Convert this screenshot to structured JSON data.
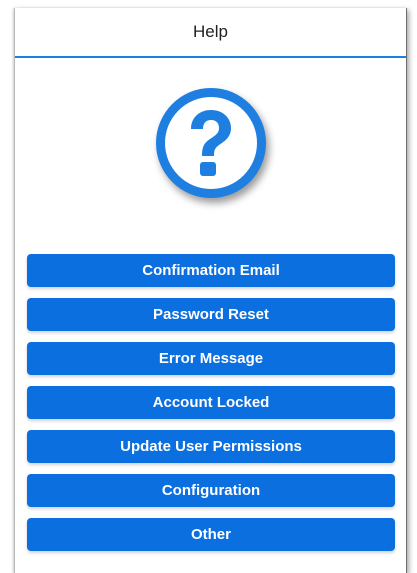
{
  "header": {
    "title": "Help"
  },
  "icon": {
    "name": "question-icon",
    "color": "#1e7fe0"
  },
  "menu": {
    "items": [
      {
        "label": "Confirmation Email"
      },
      {
        "label": "Password Reset"
      },
      {
        "label": "Error Message"
      },
      {
        "label": "Account Locked"
      },
      {
        "label": "Update User Permissions"
      },
      {
        "label": "Configuration"
      },
      {
        "label": "Other"
      }
    ]
  },
  "colors": {
    "accent": "#1e7fe0",
    "button": "#0b6fe0",
    "button_text": "#ffffff"
  }
}
